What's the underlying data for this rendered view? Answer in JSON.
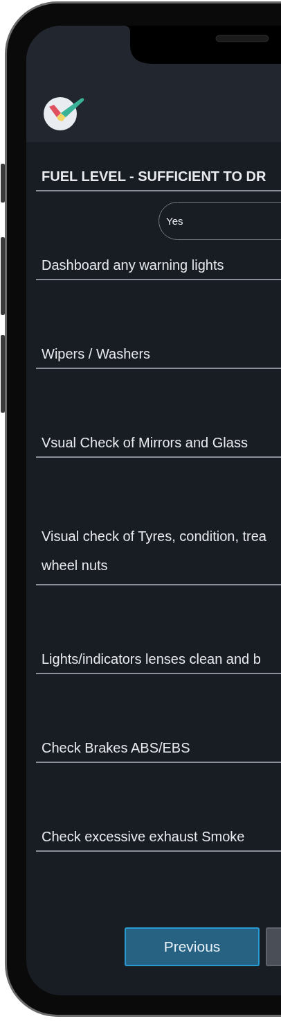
{
  "items": [
    {
      "kind": "heading",
      "label": [
        "FUEL LEVEL - SUFFICIENT TO DR"
      ],
      "answer": "Yes"
    },
    {
      "kind": "question",
      "label": [
        "Dashboard any warning lights"
      ]
    },
    {
      "kind": "question",
      "label": [
        "Wipers / Washers"
      ]
    },
    {
      "kind": "question",
      "label": [
        "Vsual Check of Mirrors and Glass"
      ]
    },
    {
      "kind": "question",
      "label": [
        "Visual check of Tyres, condition, trea",
        "wheel nuts"
      ]
    },
    {
      "kind": "question",
      "label": [
        "Lights/indicators lenses clean and b"
      ]
    },
    {
      "kind": "question",
      "label": [
        "Check Brakes ABS/EBS"
      ]
    },
    {
      "kind": "question",
      "label": [
        "Check excessive exhaust Smoke"
      ]
    }
  ],
  "buttons": [
    {
      "kind": "primary",
      "label": "Previous"
    },
    {
      "kind": "secondary"
    }
  ]
}
